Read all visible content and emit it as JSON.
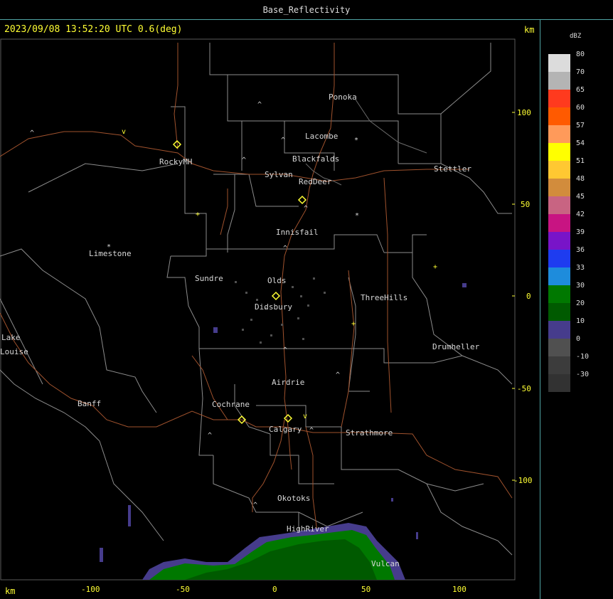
{
  "window": {
    "title": "Base_Reflectivity"
  },
  "header": {
    "timestamp": "2023/09/08 13:52:20 UTC 0.6(deg)",
    "unit_top": "km",
    "unit_bottom": "km"
  },
  "axes": {
    "x_ticks": [
      "-100",
      "-50",
      "0",
      "50",
      "100"
    ],
    "y_ticks": [
      "100",
      "50",
      "0",
      "-50",
      "-100"
    ]
  },
  "cities": [
    "Ponoka",
    "Lacombe",
    "Blackfalds",
    "RockyMH",
    "Sylvan",
    "RedDeer",
    "Stettler",
    "Innisfail",
    "Limestone",
    "Sundre",
    "Olds",
    "Didsbury",
    "ThreeHills",
    "Lake",
    "Louise",
    "Drumheller",
    "Airdrie",
    "Banff",
    "Cochrane",
    "Calgary",
    "Strathmore",
    "Okotoks",
    "HighRiver",
    "Vulcan"
  ],
  "legend": {
    "title": "dBZ",
    "entries": [
      {
        "label": "80",
        "color": "#dcdcdc"
      },
      {
        "label": "70",
        "color": "#b4b4b4"
      },
      {
        "label": "65",
        "color": "#ff3a1e"
      },
      {
        "label": "60",
        "color": "#ff5a00"
      },
      {
        "label": "57",
        "color": "#ff9a5a"
      },
      {
        "label": "54",
        "color": "#ffff00"
      },
      {
        "label": "51",
        "color": "#ffc832"
      },
      {
        "label": "48",
        "color": "#d28c3c"
      },
      {
        "label": "45",
        "color": "#c86482"
      },
      {
        "label": "42",
        "color": "#c81482"
      },
      {
        "label": "39",
        "color": "#7814c8"
      },
      {
        "label": "36",
        "color": "#1e3cf0"
      },
      {
        "label": "33",
        "color": "#1e8cdc"
      },
      {
        "label": "30",
        "color": "#007800"
      },
      {
        "label": "20",
        "color": "#005a00"
      },
      {
        "label": "10",
        "color": "#463c8c"
      },
      {
        "label": "0",
        "color": "#505050"
      },
      {
        "label": "-10",
        "color": "#3c3c3c"
      },
      {
        "label": "-30",
        "color": "#323232"
      }
    ]
  },
  "colors": {
    "frame": "#4fa3a3",
    "roads": "#a0522d",
    "boundaries": "#8c8c8c",
    "site_marker": "#ffff33",
    "ticks": "#ffff33"
  }
}
